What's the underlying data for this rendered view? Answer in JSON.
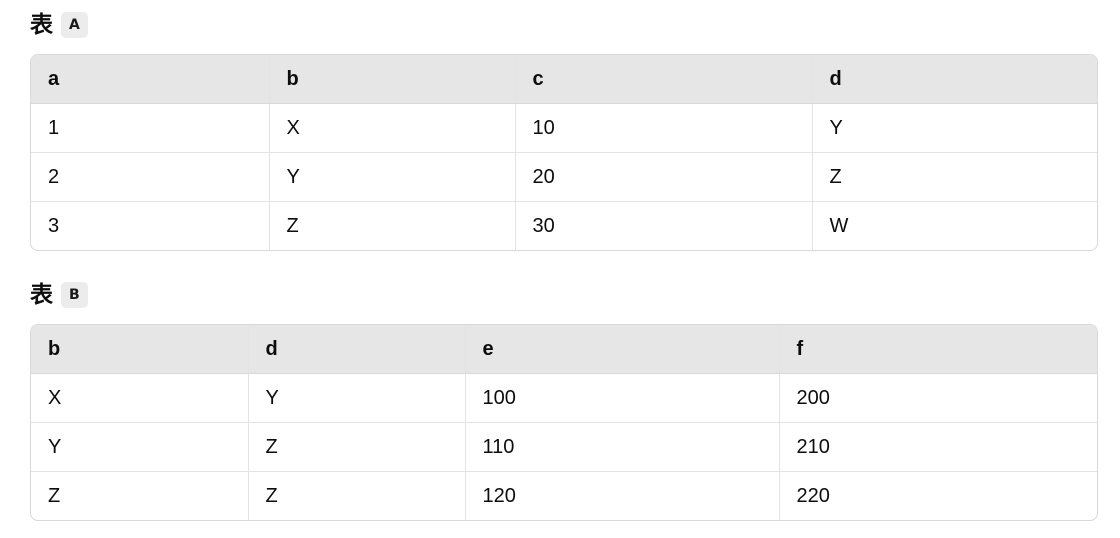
{
  "tables": [
    {
      "heading_char": "表",
      "heading_code": "A",
      "headers": [
        "a",
        "b",
        "c",
        "d"
      ],
      "rows": [
        [
          "1",
          "X",
          "10",
          "Y"
        ],
        [
          "2",
          "Y",
          "20",
          "Z"
        ],
        [
          "3",
          "Z",
          "30",
          "W"
        ]
      ]
    },
    {
      "heading_char": "表",
      "heading_code": "B",
      "headers": [
        "b",
        "d",
        "e",
        "f"
      ],
      "rows": [
        [
          "X",
          "Y",
          "100",
          "200"
        ],
        [
          "Y",
          "Z",
          "110",
          "210"
        ],
        [
          "Z",
          "Z",
          "120",
          "220"
        ]
      ]
    }
  ]
}
